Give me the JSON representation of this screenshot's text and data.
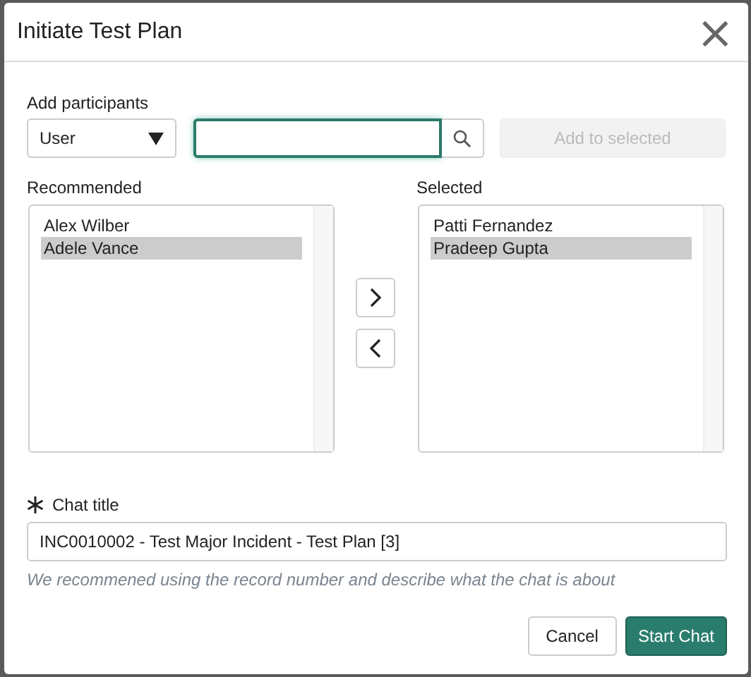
{
  "dialog": {
    "title": "Initiate Test Plan",
    "close_glyph": "×"
  },
  "participants": {
    "label": "Add participants",
    "type_select": {
      "value": "User"
    },
    "search_field": {
      "focused": true
    },
    "add_button": {
      "label": "Add to selected",
      "disabled": true
    }
  },
  "recommended": {
    "label": "Recommended",
    "items": [
      {
        "name": "Alex Wilber",
        "selected": false
      },
      {
        "name": "Adele Vance",
        "selected": true
      }
    ]
  },
  "selected_list": {
    "label": "Selected",
    "items": [
      {
        "name": "Patti Fernandez",
        "selected": false
      },
      {
        "name": "Pradeep Gupta",
        "selected": true
      }
    ]
  },
  "chat_title": {
    "label": "Chat title",
    "required": true,
    "value": "INC0010002 - Test Major Incident - Test Plan [3]",
    "hint": "We recommened using the record number and describe what the chat is about"
  },
  "buttons": [
    {
      "label": "Cancel",
      "kind": "secondary"
    },
    {
      "label": "Start Chat",
      "kind": "primary"
    }
  ]
}
